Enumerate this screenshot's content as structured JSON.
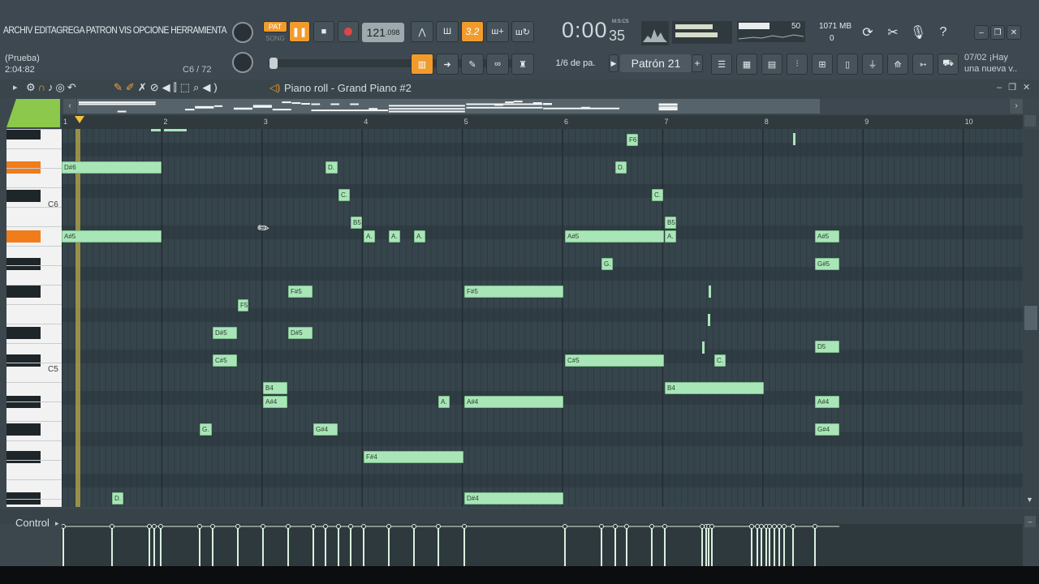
{
  "menu": {
    "text": "ARCHIV EDITAGREGA PATRON  VIS OPCIONE HERRAMIENTA"
  },
  "hint": {
    "line1": "(Prueba)",
    "line2": "2:04:82",
    "position": "C6 / 72"
  },
  "transport": {
    "pat_label": "PAT",
    "song_label": "SONG",
    "tempo": "121",
    "tempo_decimal": ".098",
    "time": "0:00",
    "time_small": "35",
    "time_unit": "M:S:CS",
    "snap_label": "1/6 de pa.",
    "pattern_label": "Patrón 21",
    "mixer_step": "3.2",
    "cpu_value": "50",
    "memory": "1071 MB",
    "voices": "0",
    "news_date": "07/02",
    "news_text1": "¡Hay",
    "news_text2": "una nueva v.."
  },
  "piano_roll": {
    "title": "Piano roll - Grand Piano #2",
    "key_labels": [
      "C6",
      "C5"
    ],
    "ruler": [
      "1",
      "2",
      "3",
      "4",
      "5",
      "6",
      "7",
      "8",
      "9",
      "10"
    ],
    "control_label": "Control"
  },
  "notes": [
    {
      "label": "D#6"
    },
    {
      "label": "A#5"
    },
    {
      "label": "D."
    },
    {
      "label": "C."
    },
    {
      "label": "B5"
    },
    {
      "label": "A."
    },
    {
      "label": "A."
    },
    {
      "label": "A."
    },
    {
      "label": "F#5"
    },
    {
      "label": "F5"
    },
    {
      "label": "D#5"
    },
    {
      "label": "D#5"
    },
    {
      "label": "C#5"
    },
    {
      "label": "B4"
    },
    {
      "label": "A#4"
    },
    {
      "label": "G."
    },
    {
      "label": "G#4"
    },
    {
      "label": "F#4"
    },
    {
      "label": "D."
    },
    {
      "label": "A."
    },
    {
      "label": "F#5"
    },
    {
      "label": "A#4"
    },
    {
      "label": "D#4"
    },
    {
      "label": "A#5"
    },
    {
      "label": "C#5"
    },
    {
      "label": "G."
    },
    {
      "label": "D."
    },
    {
      "label": "F6"
    },
    {
      "label": "C."
    },
    {
      "label": "B5"
    },
    {
      "label": "A."
    },
    {
      "label": "B4"
    },
    {
      "label": "C."
    },
    {
      "label": "A#5"
    },
    {
      "label": "G#5"
    },
    {
      "label": "D5"
    },
    {
      "label": "A#4"
    },
    {
      "label": "G#4"
    }
  ],
  "colors": {
    "accent": "#f19b2c",
    "note": "#a9e6b7",
    "grid": "#34424a",
    "highlight_key": "#f07c1a"
  }
}
